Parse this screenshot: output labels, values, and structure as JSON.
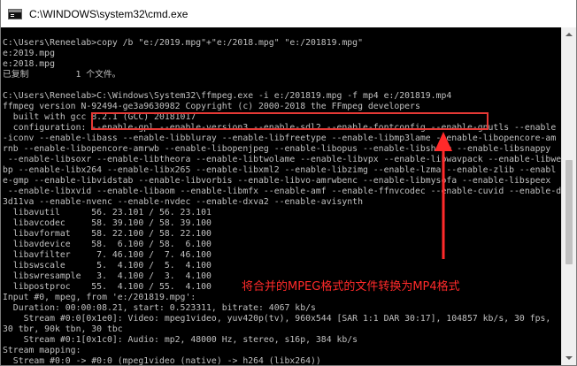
{
  "window": {
    "title": "C:\\WINDOWS\\system32\\cmd.exe",
    "icon": "cmd-icon",
    "colors": {
      "background": "#000000",
      "text": "#c0c0c0",
      "highlight": "#e53935",
      "annotation": "#ff2a2a"
    }
  },
  "console": {
    "lines": [
      "",
      "C:\\Users\\Reneelab>copy /b \"e:/2019.mpg\"+\"e:/2018.mpg\" \"e:/201819.mpg\"",
      "e:2019.mpg",
      "e:2018.mpg",
      "已复制         1 个文件。",
      "",
      "C:\\Users\\Reneelab>C:\\Windows\\System32\\ffmpeg.exe -i e:/201819.mpg -f mp4 e:/201819.mp4",
      "ffmpeg version N-92494-ge3a9630982 Copyright (c) 2000-2018 the FFmpeg developers",
      "  built with gcc 8.2.1 (GCC) 20181017",
      "  configuration: --enable-gpl --enable-version3 --enable-sdl2 --enable-fontconfig --enable-gnutls --enable",
      "-iconv --enable-libass --enable-libbluray --enable-libfreetype --enable-libmp3lame --enable-libopencore-am",
      "rnb --enable-libopencore-amrwb --enable-libopenjpeg --enable-libopus --enable-libshine --enable-libsnappy",
      " --enable-libsoxr --enable-libtheora --enable-libtwolame --enable-libvpx --enable-libwavpack --enable-libwe",
      "bp --enable-libx264 --enable-libx265 --enable-libxml2 --enable-libzimg --enable-lzma --enable-zlib --enabl",
      "e-gmp --enable-libvidstab --enable-libvorbis --enable-libvo-amrwbenc --enable-libmysofa --enable-libspeex",
      " --enable-libxvid --enable-libaom --enable-libmfx --enable-amf --enable-ffnvcodec --enable-cuvid --enable-d",
      "3d11va --enable-nvenc --enable-nvdec --enable-dxva2 --enable-avisynth",
      "  libavutil      56. 23.101 / 56. 23.101",
      "  libavcodec     58. 39.100 / 58. 39.100",
      "  libavformat    58. 22.100 / 58. 22.100",
      "  libavdevice    58.  6.100 / 58.  6.100",
      "  libavfilter     7. 46.100 /  7. 46.100",
      "  libswscale      5.  4.100 /  5.  4.100",
      "  libswresample   3.  4.100 /  3.  4.100",
      "  libpostproc    55.  4.100 / 55.  4.100",
      "Input #0, mpeg, from 'e:/201819.mpg':",
      "  Duration: 00:00:08.21, start: 0.523311, bitrate: 4067 kb/s",
      "    Stream #0:0[0x1e0]: Video: mpeg1video, yuv420p(tv), 960x544 [SAR 1:1 DAR 30:17], 104857 kb/s, 30 fps,",
      "30 tbr, 90k tbn, 30 tbc",
      "    Stream #0:1[0x1c0]: Audio: mp2, 48000 Hz, stereo, s16p, 384 kb/s",
      "Stream mapping:",
      "  Stream #0:0 -> #0:0 (mpeg1video (native) -> h264 (libx264))"
    ]
  },
  "annotation": {
    "text": "将合并的MPEG格式的文件转换为MP4格式",
    "arrow_icon": "arrow-up-icon"
  }
}
